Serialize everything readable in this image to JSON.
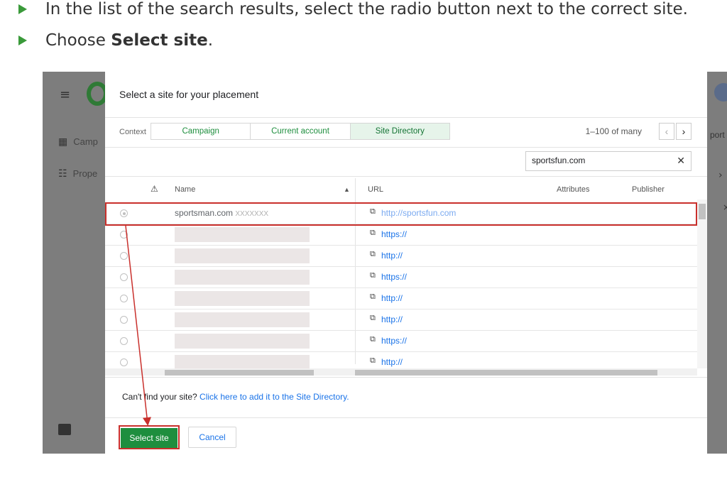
{
  "instructions": {
    "step1": "In the list of the search results, select the radio button next to the correct site.",
    "step2_prefix": "Choose ",
    "step2_bold": "Select site",
    "step2_suffix": "."
  },
  "background_app": {
    "sidebar_items": [
      "Camp",
      "Prope"
    ],
    "right_partial_text": "port"
  },
  "dialog": {
    "title": "Select a site for your placement",
    "context_label": "Context",
    "tabs": [
      {
        "label": "Campaign",
        "active": false
      },
      {
        "label": "Current account",
        "active": false
      },
      {
        "label": "Site Directory",
        "active": true
      }
    ],
    "pagination": "1–100 of many",
    "search": {
      "value": "sportsfun.com",
      "clear_icon": "close-icon"
    },
    "columns": {
      "warning_icon": "warning-icon",
      "name": "Name",
      "url": "URL",
      "attributes": "Attributes",
      "publisher": "Publisher"
    },
    "rows": [
      {
        "selected": true,
        "name": "sportsman.com",
        "name_suffix": "XXXXXXX",
        "url": "http://sportsfun.com"
      },
      {
        "selected": false,
        "url": "https://"
      },
      {
        "selected": false,
        "url": "http://"
      },
      {
        "selected": false,
        "url": "https://"
      },
      {
        "selected": false,
        "url": "http://"
      },
      {
        "selected": false,
        "url": "http://"
      },
      {
        "selected": false,
        "url": "https://"
      },
      {
        "selected": false,
        "url": "http://"
      }
    ],
    "footer": {
      "cant_find": "Can't find your site?",
      "add_link": "Click here to add it to the Site Directory."
    },
    "buttons": {
      "select": "Select site",
      "cancel": "Cancel"
    }
  },
  "colors": {
    "accent_green": "#1e8e3e",
    "highlight_red": "#c9302c",
    "link_blue": "#1a73e8"
  }
}
